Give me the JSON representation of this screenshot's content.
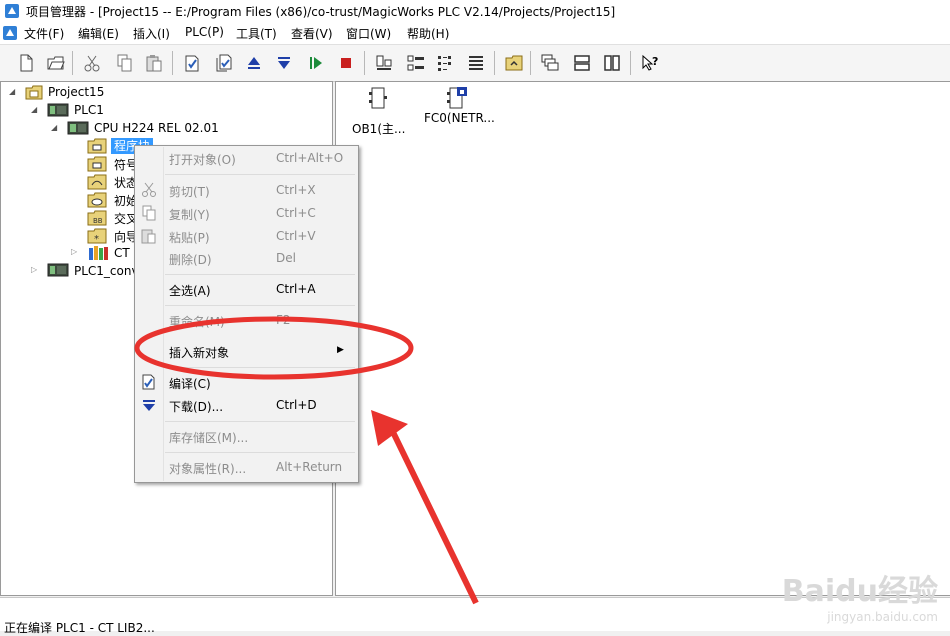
{
  "window": {
    "title": "项目管理器 - [Project15 -- E:/Program Files (x86)/co-trust/MagicWorks PLC V2.14/Projects/Project15]"
  },
  "menubar": {
    "items": [
      "文件(F)",
      "编辑(E)",
      "插入(I)",
      "PLC(P)",
      "工具(T)",
      "查看(V)",
      "窗口(W)",
      "帮助(H)"
    ]
  },
  "tree": {
    "project": "Project15",
    "plc1": "PLC1",
    "cpu": "CPU H224 REL 02.01",
    "program_block": "程序块",
    "symbols": "符号",
    "status": "状态",
    "init": "初始",
    "cross": "交叉",
    "wizard": "向导",
    "ct": "CT",
    "plc1_conv": "PLC1_conv"
  },
  "content": {
    "objects": [
      "OB1(主...",
      "FC0(NETR..."
    ]
  },
  "context_menu": {
    "items": [
      {
        "label": "打开对象(O)",
        "shortcut": "Ctrl+Alt+O",
        "enabled": false
      },
      {
        "label": "剪切(T)",
        "shortcut": "Ctrl+X",
        "enabled": false
      },
      {
        "label": "复制(Y)",
        "shortcut": "Ctrl+C",
        "enabled": false
      },
      {
        "label": "粘贴(P)",
        "shortcut": "Ctrl+V",
        "enabled": false
      },
      {
        "label": "删除(D)",
        "shortcut": "Del",
        "enabled": false
      },
      {
        "label": "全选(A)",
        "shortcut": "Ctrl+A",
        "enabled": true
      },
      {
        "label": "重命名(M)",
        "shortcut": "F2",
        "enabled": false
      },
      {
        "label": "插入新对象",
        "shortcut": "",
        "enabled": true,
        "submenu": true
      },
      {
        "label": "编译(C)",
        "shortcut": "",
        "enabled": true
      },
      {
        "label": "下载(D)...",
        "shortcut": "Ctrl+D",
        "enabled": true
      },
      {
        "label": "库存储区(M)...",
        "shortcut": "",
        "enabled": false
      },
      {
        "label": "对象属性(R)...",
        "shortcut": "Alt+Return",
        "enabled": false
      }
    ]
  },
  "statusbar": {
    "text": "正在编译 PLC1 - CT LIB2..."
  },
  "watermark": {
    "brand": "Baidu经验",
    "url": "jingyan.baidu.com"
  },
  "colors": {
    "selection": "#3399ff",
    "annotation": "#e8332e",
    "folder": "#e8d27a"
  }
}
